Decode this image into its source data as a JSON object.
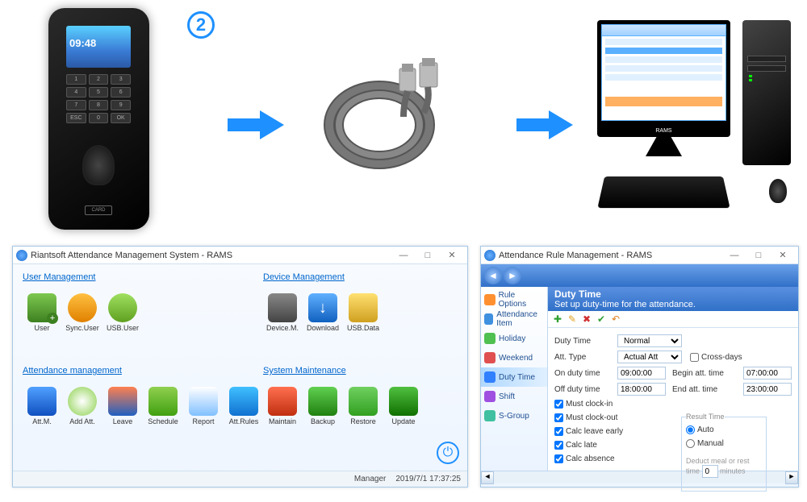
{
  "step_number": "2",
  "terminal_time": "09:48",
  "terminal_card": "CARD",
  "monitor_brand": "RAMS",
  "window1": {
    "title": "Riantsoft Attendance Management System - RAMS",
    "groups": {
      "user_mgmt": "User Management",
      "device_mgmt": "Device Management",
      "att_mgmt": "Attendance management",
      "sys_maint": "System Maintenance"
    },
    "buttons": {
      "user": "User",
      "syncuser": "Sync.User",
      "usbuser": "USB.User",
      "devicem": "Device.M.",
      "download": "Download",
      "usbdata": "USB.Data",
      "attm": "Att.M.",
      "addatt": "Add Att.",
      "leave": "Leave",
      "schedule": "Schedule",
      "report": "Report",
      "attrules": "Att.Rules",
      "maintain": "Maintain",
      "backup": "Backup",
      "restore": "Restore",
      "update": "Update"
    },
    "status": {
      "user": "Manager",
      "datetime": "2019/7/1 17:37:25"
    }
  },
  "window2": {
    "title": "Attendance Rule Management - RAMS",
    "sidebar": {
      "ruleopt": "Rule Options",
      "attitem": "Attendance Item",
      "holiday": "Holiday",
      "weekend": "Weekend",
      "dutytime": "Duty Time",
      "shift": "Shift",
      "sgroup": "S-Group"
    },
    "header": {
      "title": "Duty Time",
      "sub": "Set up duty-time for the attendance."
    },
    "form": {
      "dutytime_lbl": "Duty Time",
      "dutytime_val": "Normal",
      "atttype_lbl": "Att. Type",
      "atttype_val": "Actual Att",
      "crossdays": "Cross-days",
      "onduty_lbl": "On duty time",
      "onduty_val": "09:00:00",
      "beginatt_lbl": "Begin att. time",
      "beginatt_val": "07:00:00",
      "offduty_lbl": "Off duty time",
      "offduty_val": "18:00:00",
      "endatt_lbl": "End att. time",
      "endatt_val": "23:00:00",
      "mustin": "Must clock-in",
      "mustout": "Must clock-out",
      "calcearly": "Calc leave early",
      "calclate": "Calc late",
      "calcabs": "Calc absence",
      "result_lbl": "Result Time",
      "auto": "Auto",
      "manual": "Manual",
      "deduct_lbl": "Deduct meal or rest time",
      "deduct_val": "0",
      "deduct_unit": "minutes"
    }
  }
}
